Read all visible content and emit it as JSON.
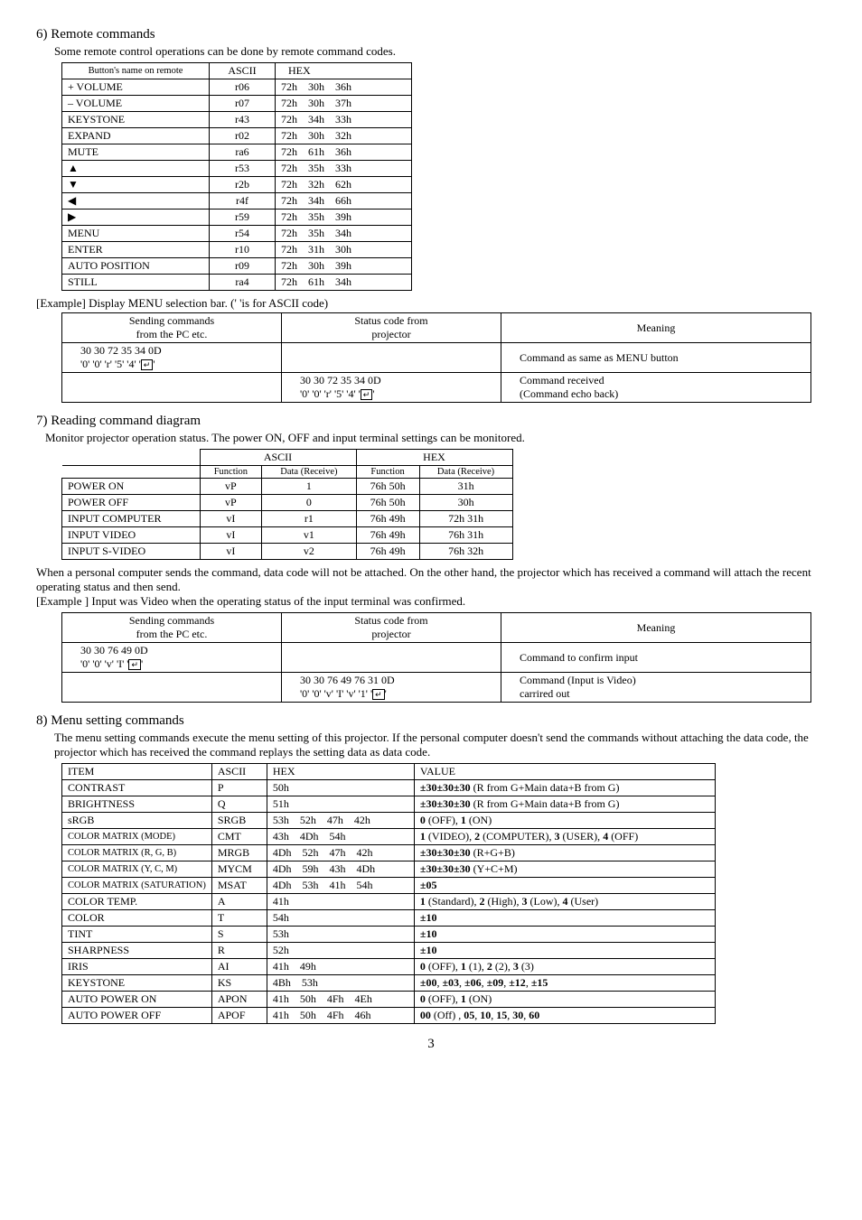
{
  "sec6": {
    "heading": "6) Remote commands",
    "intro": "Some remote control operations can be done by remote command codes.",
    "headers": [
      "Button's name on remote",
      "ASCII",
      "HEX"
    ],
    "rows": [
      {
        "name": "+ VOLUME",
        "ascii": "r06",
        "hex": "72h   30h   36h"
      },
      {
        "name": "– VOLUME",
        "ascii": "r07",
        "hex": "72h   30h   37h"
      },
      {
        "name": "KEYSTONE",
        "ascii": "r43",
        "hex": "72h   34h   33h"
      },
      {
        "name": "EXPAND",
        "ascii": "r02",
        "hex": "72h   30h   32h"
      },
      {
        "name": "MUTE",
        "ascii": "ra6",
        "hex": "72h   61h   36h"
      },
      {
        "name": "__ARROW_UP__",
        "ascii": "r53",
        "hex": "72h   35h   33h"
      },
      {
        "name": "__ARROW_DOWN__",
        "ascii": "r2b",
        "hex": "72h   32h   62h"
      },
      {
        "name": "__ARROW_LEFT__",
        "ascii": "r4f",
        "hex": "72h   34h   66h"
      },
      {
        "name": "__ARROW_RIGHT__",
        "ascii": "r59",
        "hex": "72h   35h   39h"
      },
      {
        "name": "MENU",
        "ascii": "r54",
        "hex": "72h   35h   34h"
      },
      {
        "name": "ENTER",
        "ascii": "r10",
        "hex": "72h   31h   30h"
      },
      {
        "name": "AUTO POSITION",
        "ascii": "r09",
        "hex": "72h   30h   39h"
      },
      {
        "name": "STILL",
        "ascii": "ra4",
        "hex": "72h   61h   34h"
      }
    ],
    "example_label": "[Example] Display MENU selection bar. ('  'is for ASCII code)",
    "ex_headers": [
      "Sending commands\nfrom the PC etc.",
      "Status code from\nprojector",
      "Meaning"
    ],
    "ex_rows": [
      {
        "send": "30 30 72 35 34 0D",
        "send2": "'0' '0' 'r' '5' '4' '__ENTER__'",
        "status": "",
        "meaning": "Command as same as MENU button"
      },
      {
        "send": "",
        "send2": "",
        "status": "30 30 72 35 34 0D",
        "status2": "'0' '0' 'r' '5' '4' '__ENTER__'",
        "meaning": "Command received\n(Command echo back)"
      }
    ]
  },
  "sec7": {
    "heading": "7) Reading command diagram",
    "intro": "Monitor projector operation status. The power ON, OFF and input terminal settings can be monitored.",
    "headers_top": [
      "",
      "ASCII",
      "HEX"
    ],
    "headers_sub": [
      "",
      "Function",
      "Data (Receive)",
      "Function",
      "Data (Receive)"
    ],
    "rows": [
      {
        "name": "POWER ON",
        "af": "vP",
        "ad": "1",
        "hf": "76h 50h",
        "hd": "31h"
      },
      {
        "name": "POWER OFF",
        "af": "vP",
        "ad": "0",
        "hf": "76h 50h",
        "hd": "30h"
      },
      {
        "name": "INPUT COMPUTER",
        "af": "vI",
        "ad": "r1",
        "hf": "76h 49h",
        "hd": "72h 31h"
      },
      {
        "name": "INPUT VIDEO",
        "af": "vI",
        "ad": "v1",
        "hf": "76h 49h",
        "hd": "76h 31h"
      },
      {
        "name": "INPUT S-VIDEO",
        "af": "vI",
        "ad": "v2",
        "hf": "76h 49h",
        "hd": "76h 32h"
      }
    ],
    "para1": "When a personal computer sends the command, data code will not be attached. On the other hand, the projector which has received a command will attach the recent operating status and then send.",
    "para2": "[Example ]  Input was Video when the operating status of the input terminal was confirmed.",
    "ex_headers": [
      "Sending commands\nfrom the PC etc.",
      "Status code from\nprojector",
      "Meaning"
    ],
    "ex_rows": [
      {
        "send": "30 30 76 49 0D",
        "send2": "'0' '0' 'v' 'I' '__ENTER__'",
        "status": "",
        "meaning": "Command to confirm input"
      },
      {
        "send": "",
        "send2": "",
        "status": "30 30 76 49 76 31 0D",
        "status2": "'0' '0' 'v' 'I' 'v' '1' '__ENTER__'",
        "meaning": "Command (Input is Video)\ncarrired out"
      }
    ]
  },
  "sec8": {
    "heading": "8) Menu setting commands",
    "intro": "The menu setting commands execute the menu setting of this projector. If the personal computer doesn't send the commands without attaching the data code, the projector which has received the command replays the setting data as data code.",
    "headers": [
      "ITEM",
      "ASCII",
      "HEX",
      "VALUE"
    ],
    "rows": [
      {
        "item": "CONTRAST",
        "ascii": "P",
        "hex": "50h",
        "value": "±30±30±30 (R from G+Main data+B from G)"
      },
      {
        "item": "BRIGHTNESS",
        "ascii": "Q",
        "hex": "51h",
        "value": "±30±30±30 (R from G+Main data+B from G)"
      },
      {
        "item": "sRGB",
        "ascii": "SRGB",
        "hex": "53h   52h   47h   42h",
        "value": "0 (OFF), 1 (ON)"
      },
      {
        "item": "COLOR MATRIX (MODE)",
        "small": true,
        "ascii": "CMT",
        "hex": "43h   4Dh   54h",
        "value": "1 (VIDEO), 2 (COMPUTER), 3 (USER), 4 (OFF)"
      },
      {
        "item": "COLOR MATRIX (R, G, B)",
        "small": true,
        "ascii": "MRGB",
        "hex": "4Dh   52h   47h   42h",
        "value": "±30±30±30  (R+G+B)"
      },
      {
        "item": "COLOR MATRIX (Y, C, M)",
        "small": true,
        "ascii": "MYCM",
        "hex": "4Dh   59h   43h   4Dh",
        "value": "±30±30±30  (Y+C+M)"
      },
      {
        "item": "COLOR MATRIX (SATURATION)",
        "small": true,
        "ascii": "MSAT",
        "hex": "4Dh   53h   41h   54h",
        "value": "±05"
      },
      {
        "item": "COLOR TEMP.",
        "ascii": "A",
        "hex": "41h",
        "value": "1 (Standard), 2 (High), 3 (Low), 4 (User)"
      },
      {
        "item": "COLOR",
        "ascii": "T",
        "hex": "54h",
        "value": "±10"
      },
      {
        "item": "TINT",
        "ascii": "S",
        "hex": "53h",
        "value": "±10"
      },
      {
        "item": "SHARPNESS",
        "ascii": "R",
        "hex": "52h",
        "value": "±10"
      },
      {
        "item": "IRIS",
        "ascii": "AI",
        "hex": "41h   49h",
        "value": "0 (OFF), 1 (1), 2 (2), 3 (3)"
      },
      {
        "item": "KEYSTONE",
        "ascii": "KS",
        "hex": "4Bh   53h",
        "value": "±00, ±03, ±06, ±09, ±12, ±15"
      },
      {
        "item": "AUTO POWER ON",
        "ascii": "APON",
        "hex": "41h   50h   4Fh   4Eh",
        "value": "0 (OFF), 1 (ON)"
      },
      {
        "item": "AUTO POWER OFF",
        "ascii": "APOF",
        "hex": "41h   50h   4Fh   46h",
        "value": "00 (Off) , 05, 10, 15, 30, 60"
      }
    ]
  },
  "page_number": "3"
}
